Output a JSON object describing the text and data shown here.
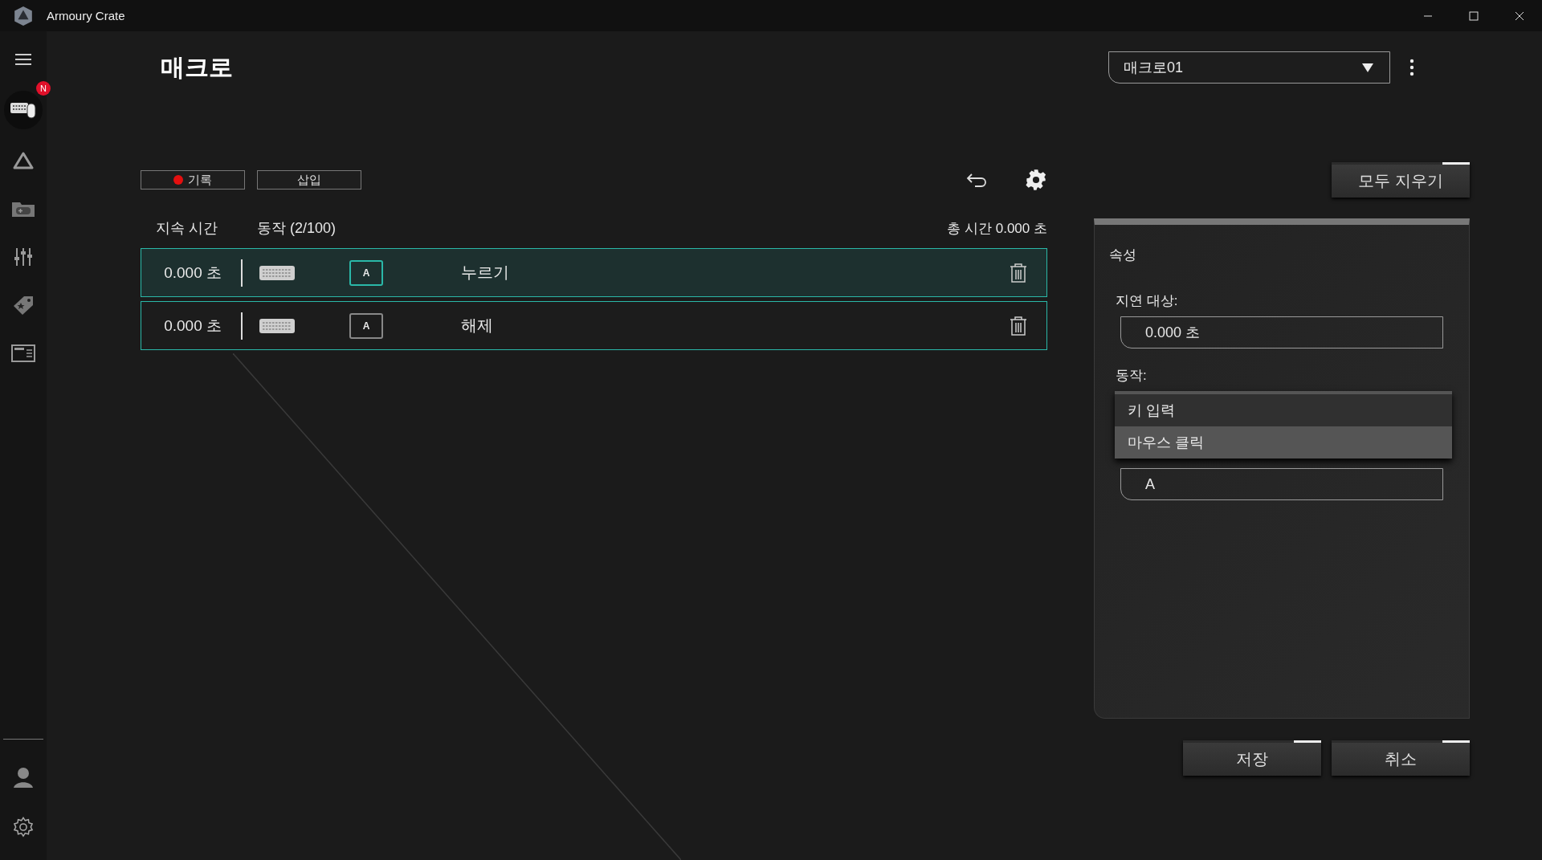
{
  "window": {
    "title": "Armoury Crate"
  },
  "sidebar": {
    "items": [
      {
        "kind": "menu",
        "selected": false
      },
      {
        "kind": "device",
        "selected": true,
        "badge": "N"
      },
      {
        "kind": "aura",
        "selected": false
      },
      {
        "kind": "game",
        "selected": false
      },
      {
        "kind": "mixer",
        "selected": false
      },
      {
        "kind": "deals",
        "selected": false
      },
      {
        "kind": "news",
        "selected": false
      }
    ],
    "bottom_items": [
      {
        "kind": "user",
        "selected": false
      },
      {
        "kind": "settings",
        "selected": false
      }
    ]
  },
  "page": {
    "title": "매크로",
    "profile_dropdown": {
      "value": "매크로01"
    }
  },
  "toolbar": {
    "record_button": "기록",
    "insert_button": "삽입",
    "clear_all_button": "모두 지우기"
  },
  "table": {
    "columns": [
      "지속 시간",
      "동작 (2/100)"
    ],
    "total_time": "총 시간 0.000 초",
    "rows": [
      {
        "duration": "0.000 초",
        "key": "A",
        "action": "누르기",
        "selected": true
      },
      {
        "duration": "0.000 초",
        "key": "A",
        "action": "해제",
        "selected": false
      }
    ]
  },
  "properties": {
    "title": "속성",
    "delay_label": "지연 대상:",
    "delay_value": "0.000 초",
    "action_label": "동작:",
    "action_options": [
      {
        "label": "키 입력",
        "selected": false
      },
      {
        "label": "마우스 클릭",
        "selected": true
      }
    ],
    "key_value": "A"
  },
  "buttons": [
    {
      "label": "저장"
    },
    {
      "label": "취소"
    }
  ]
}
